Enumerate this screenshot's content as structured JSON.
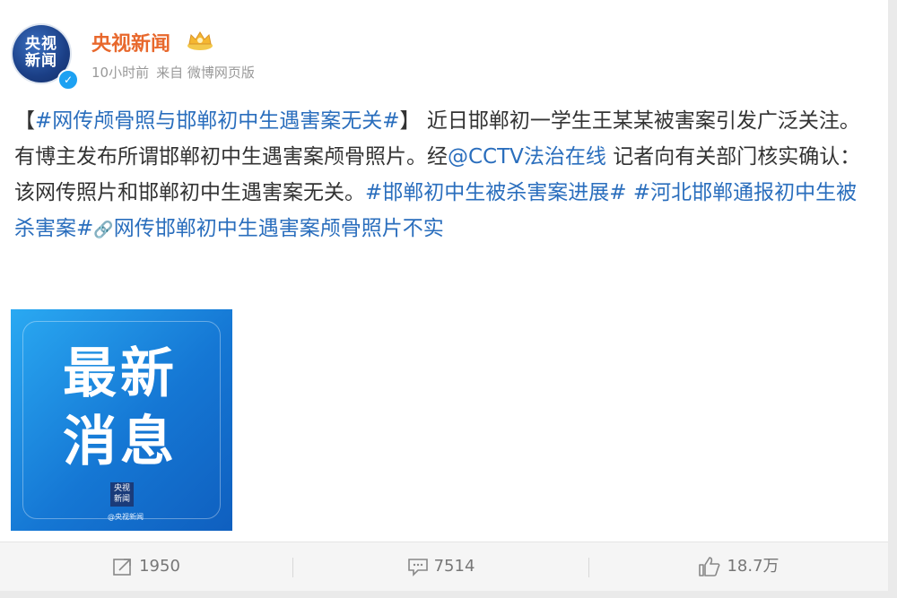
{
  "author": {
    "avatar_text_line1": "央视",
    "avatar_text_line2": "新闻",
    "name": "央视新闻",
    "time": "10小时前",
    "source": "来自 微博网页版"
  },
  "post": {
    "bracket_open": "【",
    "title_tag": "#网传颅骨照与邯郸初中生遇害案无关#",
    "bracket_close": "】",
    "text1": "近日邯郸初一学生王某某被害案引发广泛关注。有博主发布所谓邯郸初中生遇害案颅骨照片。经",
    "mention": "@CCTV法治在线",
    "text2": " 记者向有关部门核实确认：该网传照片和邯郸初中生遇害案无关。",
    "tag2": "#邯郸初中生被杀害案进展#",
    "tag3": " #河北邯郸通报初中生被杀害案#",
    "link_icon": "link-icon",
    "link_text": "网传邯郸初中生遇害案颅骨照片不实"
  },
  "image": {
    "line1": "最新",
    "line2": "消息",
    "mini_logo_line1": "央视",
    "mini_logo_line2": "新闻",
    "credit": "@央视新闻"
  },
  "actions": {
    "repost_count": "1950",
    "comment_count": "7514",
    "like_count": "18.7万"
  },
  "colors": {
    "username": "#e8682c",
    "link": "#2a6ebd",
    "verified": "#1da1f2"
  }
}
